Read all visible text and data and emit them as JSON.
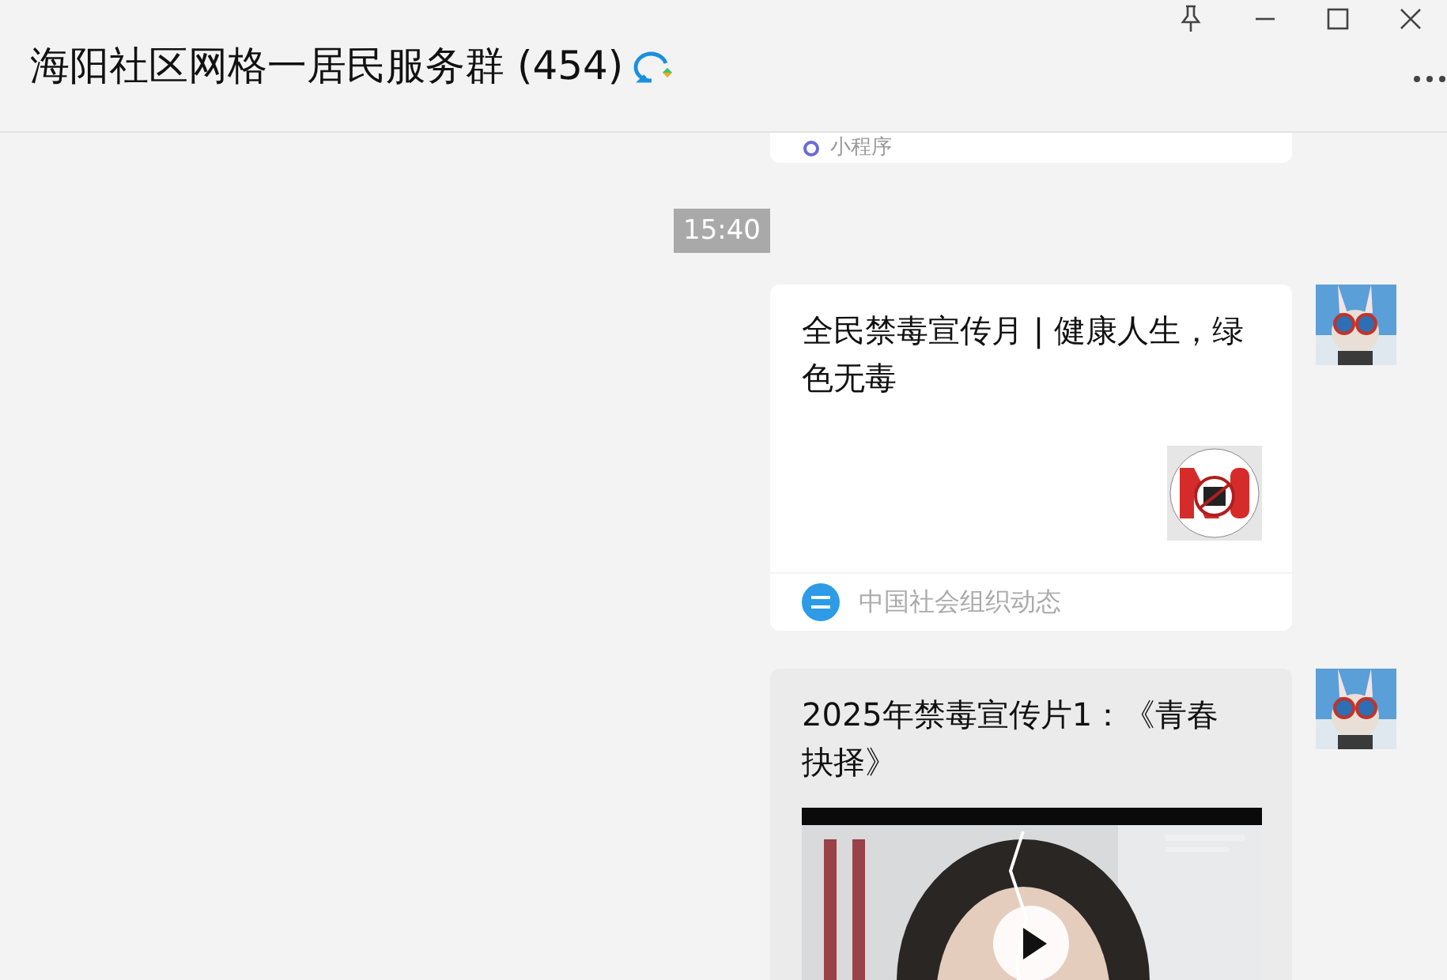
{
  "window": {
    "title": "海阳社区网格一居民服务群 (454)"
  },
  "messages": [
    {
      "kind": "stub",
      "source": "小程序"
    },
    {
      "kind": "time",
      "text": "15:40"
    },
    {
      "kind": "article",
      "title": "全民禁毒宣传月 | 健康人生，绿色无毒",
      "source": "中国社会组织动态",
      "hovered": false
    },
    {
      "kind": "video",
      "title": "2025年禁毒宣传片1：《青春抉择》",
      "hovered": true
    }
  ]
}
